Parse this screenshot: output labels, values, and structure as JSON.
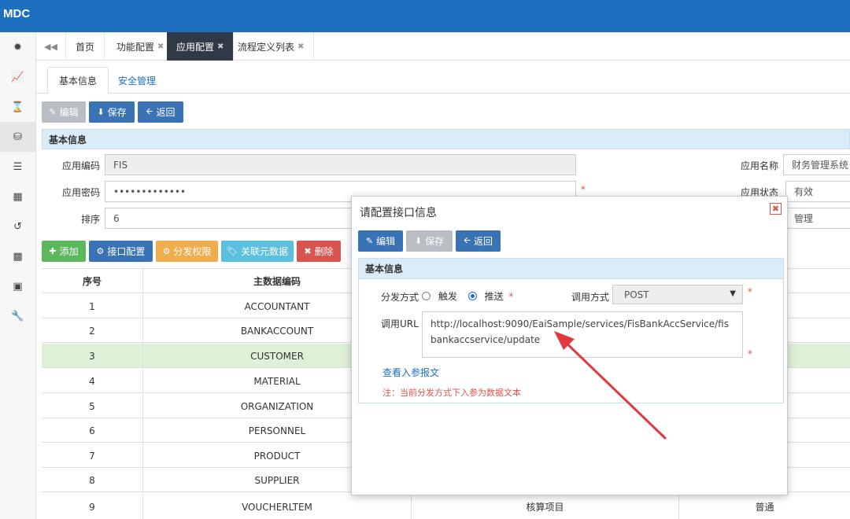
{
  "app": {
    "brand": "MDC"
  },
  "sidebar": {
    "icons": [
      "dashboard-icon",
      "chart-icon",
      "spinner-icon",
      "database-icon",
      "list-icon",
      "grid-icon",
      "history-icon",
      "film-icon",
      "archive-icon",
      "wrench-icon"
    ],
    "active_index": 3
  },
  "tabs": [
    {
      "label": "首页",
      "closable": false
    },
    {
      "label": "功能配置",
      "closable": true
    },
    {
      "label": "应用配置",
      "closable": true,
      "active": true
    },
    {
      "label": "流程定义列表",
      "closable": true
    }
  ],
  "subtabs": [
    "基本信息",
    "安全管理"
  ],
  "toolbar": {
    "edit": "编辑",
    "save": "保存",
    "back": "返回"
  },
  "basic": {
    "header": "基本信息",
    "app_code_label": "应用编码",
    "app_code_value": "FIS",
    "app_pwd_label": "应用密码",
    "app_pwd_value": "•••••••••••••",
    "sort_label": "排序",
    "sort_value": "6",
    "app_name_label": "应用名称",
    "app_name_value": "财务管理系统",
    "app_status_label": "应用状态",
    "app_status_value": "有效",
    "third_value": "管理",
    "required_mark": "*"
  },
  "actions": {
    "add": "添加",
    "iface": "接口配置",
    "perm": "分发权限",
    "meta": "关联元数据",
    "del": "删除"
  },
  "grid": {
    "headers": [
      "序号",
      "主数据编码"
    ],
    "rows": [
      {
        "no": "1",
        "code": "ACCOUNTANT"
      },
      {
        "no": "2",
        "code": "BANKACCOUNT"
      },
      {
        "no": "3",
        "code": "CUSTOMER"
      },
      {
        "no": "4",
        "code": "MATERIAL"
      },
      {
        "no": "5",
        "code": "ORGANIZATION"
      },
      {
        "no": "6",
        "code": "PERSONNEL"
      },
      {
        "no": "7",
        "code": "PRODUCT"
      },
      {
        "no": "8",
        "code": "SUPPLIER"
      },
      {
        "no": "9",
        "code": "VOUCHERLTEM",
        "name": "核算项目",
        "type": "普通"
      }
    ],
    "selected_index": 2
  },
  "modal": {
    "title": "请配置接口信息",
    "edit": "编辑",
    "save": "保存",
    "back": "返回",
    "header": "基本信息",
    "dist_label": "分发方式",
    "opt_trigger": "触发",
    "opt_push": "推送",
    "call_label": "调用方式",
    "call_value": "POST",
    "url_label": "调用URL",
    "url_value": "http://localhost:9090/EaiSample/services/FisBankAccService/fisbankaccservice/update",
    "view_link": "查看入参报文",
    "note": "注：当前分发方式下入参为数据文本",
    "required": "*"
  },
  "colors": {
    "topbar": "#1e6fc0",
    "blue_btn": "#3a73b5",
    "arrow": "#e0393e"
  }
}
